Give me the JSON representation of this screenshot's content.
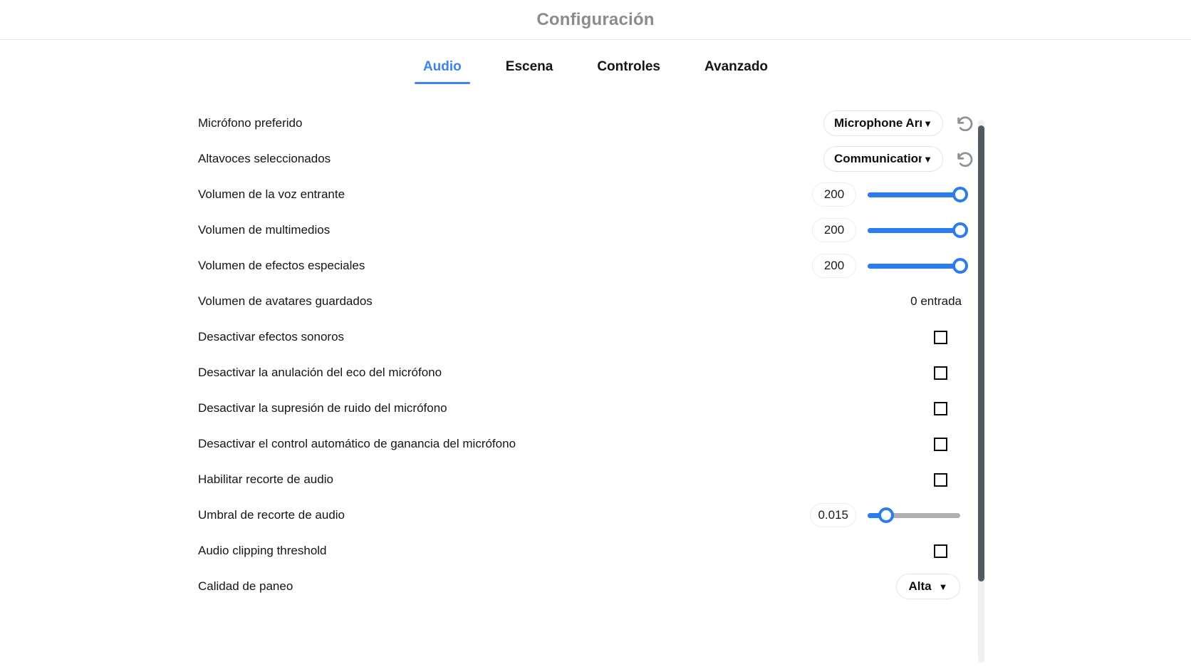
{
  "header": {
    "title": "Configuración"
  },
  "tabs": [
    {
      "label": "Audio",
      "active": true
    },
    {
      "label": "Escena",
      "active": false
    },
    {
      "label": "Controles",
      "active": false
    },
    {
      "label": "Avanzado",
      "active": false
    }
  ],
  "settings": [
    {
      "label": "Micrófono preferido",
      "control": "dropdown-reset",
      "value": "Microphone Array",
      "caret": "▼",
      "reset_icon": "undo-arrow-icon"
    },
    {
      "label": "Altavoces seleccionados",
      "control": "dropdown-reset",
      "value": "Communications",
      "caret": "▼",
      "reset_icon": "undo-arrow-icon"
    },
    {
      "label": "Volumen de la voz entrante",
      "control": "slider",
      "value": "200",
      "percent": 100
    },
    {
      "label": "Volumen de multimedios",
      "control": "slider",
      "value": "200",
      "percent": 100
    },
    {
      "label": "Volumen de efectos especiales",
      "control": "slider",
      "value": "200",
      "percent": 100
    },
    {
      "label": "Volumen de avatares guardados",
      "control": "text",
      "value": "0 entrada"
    },
    {
      "label": "Desactivar efectos sonoros",
      "control": "checkbox",
      "checked": false
    },
    {
      "label": "Desactivar la anulación del eco del micrófono",
      "control": "checkbox",
      "checked": false
    },
    {
      "label": "Desactivar la supresión de ruido del micrófono",
      "control": "checkbox",
      "checked": false
    },
    {
      "label": "Desactivar el control automático de ganancia del micrófono",
      "control": "checkbox",
      "checked": false
    },
    {
      "label": "Habilitar recorte de audio",
      "control": "checkbox",
      "checked": false
    },
    {
      "label": "Umbral de recorte de audio",
      "control": "slider",
      "value": "0.015",
      "percent": 20
    },
    {
      "label": "Audio clipping threshold",
      "control": "checkbox",
      "checked": false
    },
    {
      "label": "Calidad de paneo",
      "control": "dropdown-small",
      "value": "Alta",
      "caret": "▼"
    }
  ],
  "colors": {
    "accent": "#3c82f0",
    "slider_fill": "#2a7cf0",
    "slider_track": "#b0b0b2",
    "title": "#8b8b8e",
    "text": "#14151a",
    "scrollbar_thumb": "#545a61"
  },
  "scrollbar": {
    "name": "vertical-scrollbar"
  }
}
